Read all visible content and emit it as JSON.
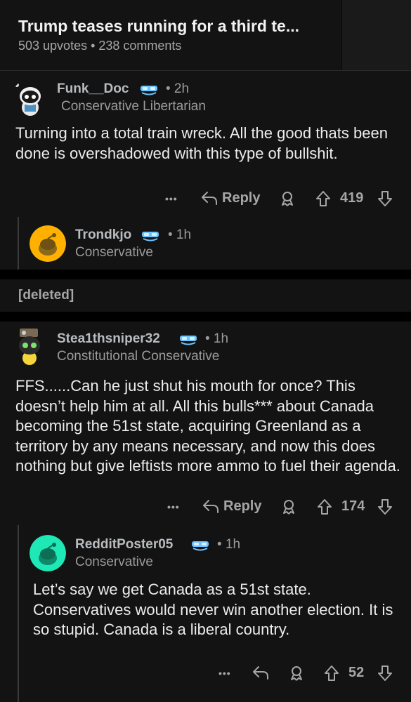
{
  "post": {
    "title": "Trump teases running for a third te...",
    "meta": "503 upvotes • 238 comments"
  },
  "comments": [
    {
      "username": "Funk__Doc",
      "time": "• 2h",
      "flair": "Conservative Libertarian",
      "body": "Turning into a total train wreck. All the good thats been done is overshadowed with this type of bullshit.",
      "more": "•••",
      "reply_label": "Reply",
      "votes": "419"
    },
    {
      "username": "Trondkjo",
      "time": "• 1h",
      "flair": "Conservative"
    },
    {
      "deleted_label": "[deleted]"
    },
    {
      "username": "Stea1thsniper32",
      "time": "• 1h",
      "flair": "Constitutional Conservative",
      "body": "FFS......Can he just shut his mouth for once? This doesn’t help him at all. All this bulls*** about Canada becoming the 51st state, acquiring Greenland as a territory by any means necessary, and now this does nothing but give leftists more ammo to fuel their agenda.",
      "more": "•••",
      "reply_label": "Reply",
      "votes": "174"
    },
    {
      "username": "RedditPoster05",
      "time": "• 1h",
      "flair": "Conservative",
      "body": "Let’s say we get Canada as a 51st state. Conservatives would never win another election. It is so stupid. Canada is a liberal country.",
      "more": "•••",
      "votes": "52"
    }
  ],
  "colors": {
    "background": "#000000",
    "card": "#131313",
    "text": "#ececec",
    "muted": "#9b9b9b",
    "flair_icon": "#6cc3ff"
  }
}
